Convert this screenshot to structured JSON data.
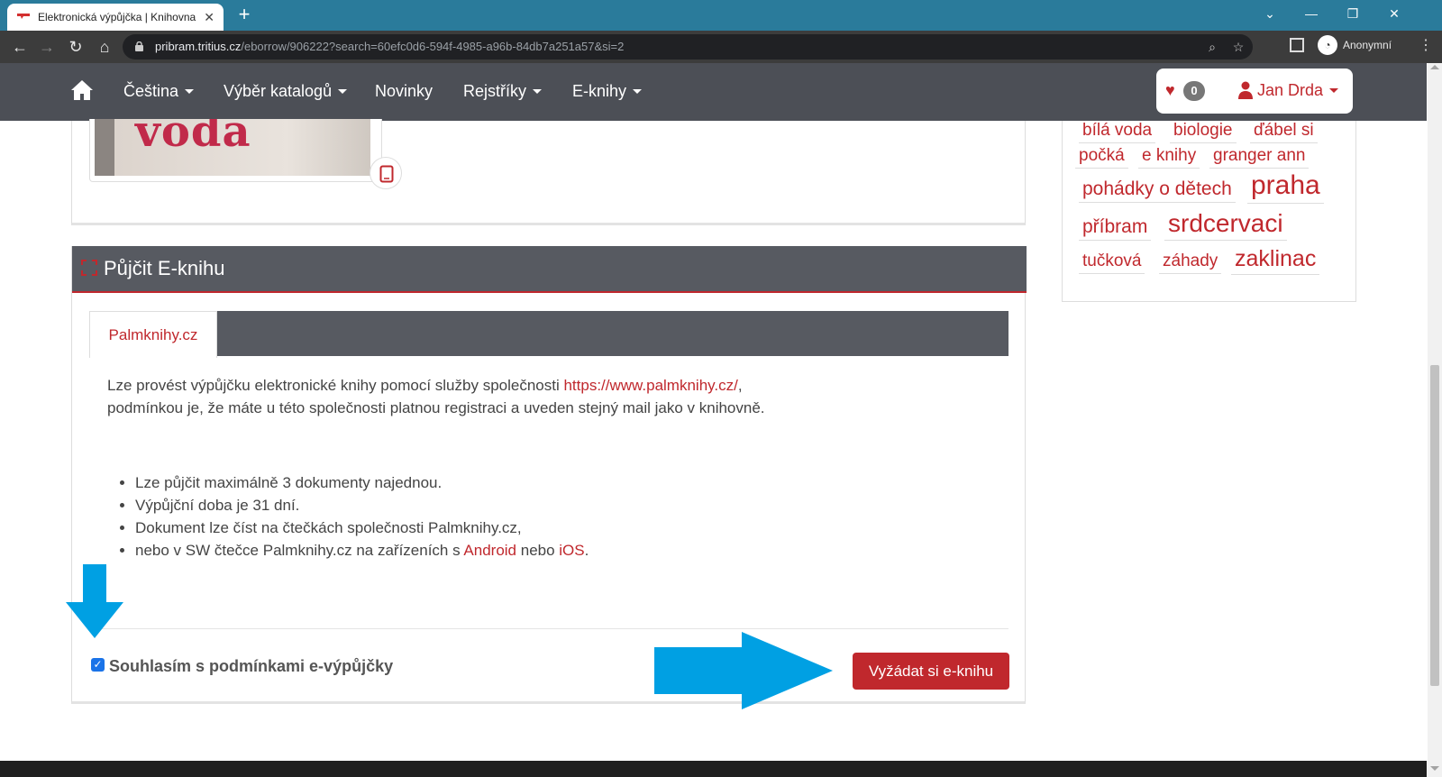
{
  "browser": {
    "tab_title": "Elektronická výpůjčka | Knihovna",
    "tab_close": "✕",
    "new_tab": "+",
    "url_host": "pribram.tritius.cz",
    "url_path": "/eborrow/906222?search=60efc0d6-594f-4985-a96b-84db7a251a57&si=2",
    "profile_label": "Anonymní",
    "icons": [
      "back-icon",
      "forward-icon",
      "reload-icon",
      "home-icon",
      "lock-icon",
      "zoom-icon",
      "star-icon",
      "side-panel-icon",
      "incognito-icon",
      "menu-icon"
    ]
  },
  "nav": {
    "items": [
      {
        "label": "Čeština",
        "dropdown": true
      },
      {
        "label": "Výběr katalogů",
        "dropdown": true
      },
      {
        "label": "Novinky",
        "dropdown": false
      },
      {
        "label": "Rejstříky",
        "dropdown": true
      },
      {
        "label": "E-knihy",
        "dropdown": true
      }
    ],
    "favorites_count": "0",
    "user_name": "Jan Drda"
  },
  "cover": {
    "text": "voda"
  },
  "borrow": {
    "title": "Půjčit E-knihu",
    "tab_label": "Palmknihy.cz",
    "desc_before_link": "Lze provést výpůjčku elektronické knihy pomocí služby společnosti ",
    "desc_link": "https://www.palmknihy.cz/",
    "desc_after_link": ",",
    "desc_line2": "podmínkou je, že máte u této společnosti platnou registraci a uveden stejný mail jako v knihovně.",
    "conditions": [
      "Lze půjčit maximálně 3 dokumenty najednou.",
      "Výpůjční doba je 31 dní.",
      "Dokument lze číst na čtečkách společnosti Palmknihy.cz,"
    ],
    "condition4_before": "nebo v SW čtečce Palmknihy.cz na zařízeních s ",
    "condition4_link1": "Android",
    "condition4_middle": " nebo ",
    "condition4_link2": "iOS",
    "condition4_after": ".",
    "agree_label": "Souhlasím s podmínkami e-výpůjčky",
    "agree_checked": true,
    "request_button": "Vyžádat si e-knihu"
  },
  "tags": [
    "bílá voda",
    "biologie",
    "ďábel si",
    "počká",
    "e knihy",
    "granger ann",
    "pohádky o dětech",
    "praha",
    "příbram",
    "srdcervaci",
    "tučková",
    "záhady",
    "zaklinac"
  ],
  "colors": {
    "accent_red": "#c0282d",
    "nav_gray": "#4c4f56",
    "annotation_blue": "#00a0e3",
    "chrome_teal": "#2a7b9b"
  }
}
